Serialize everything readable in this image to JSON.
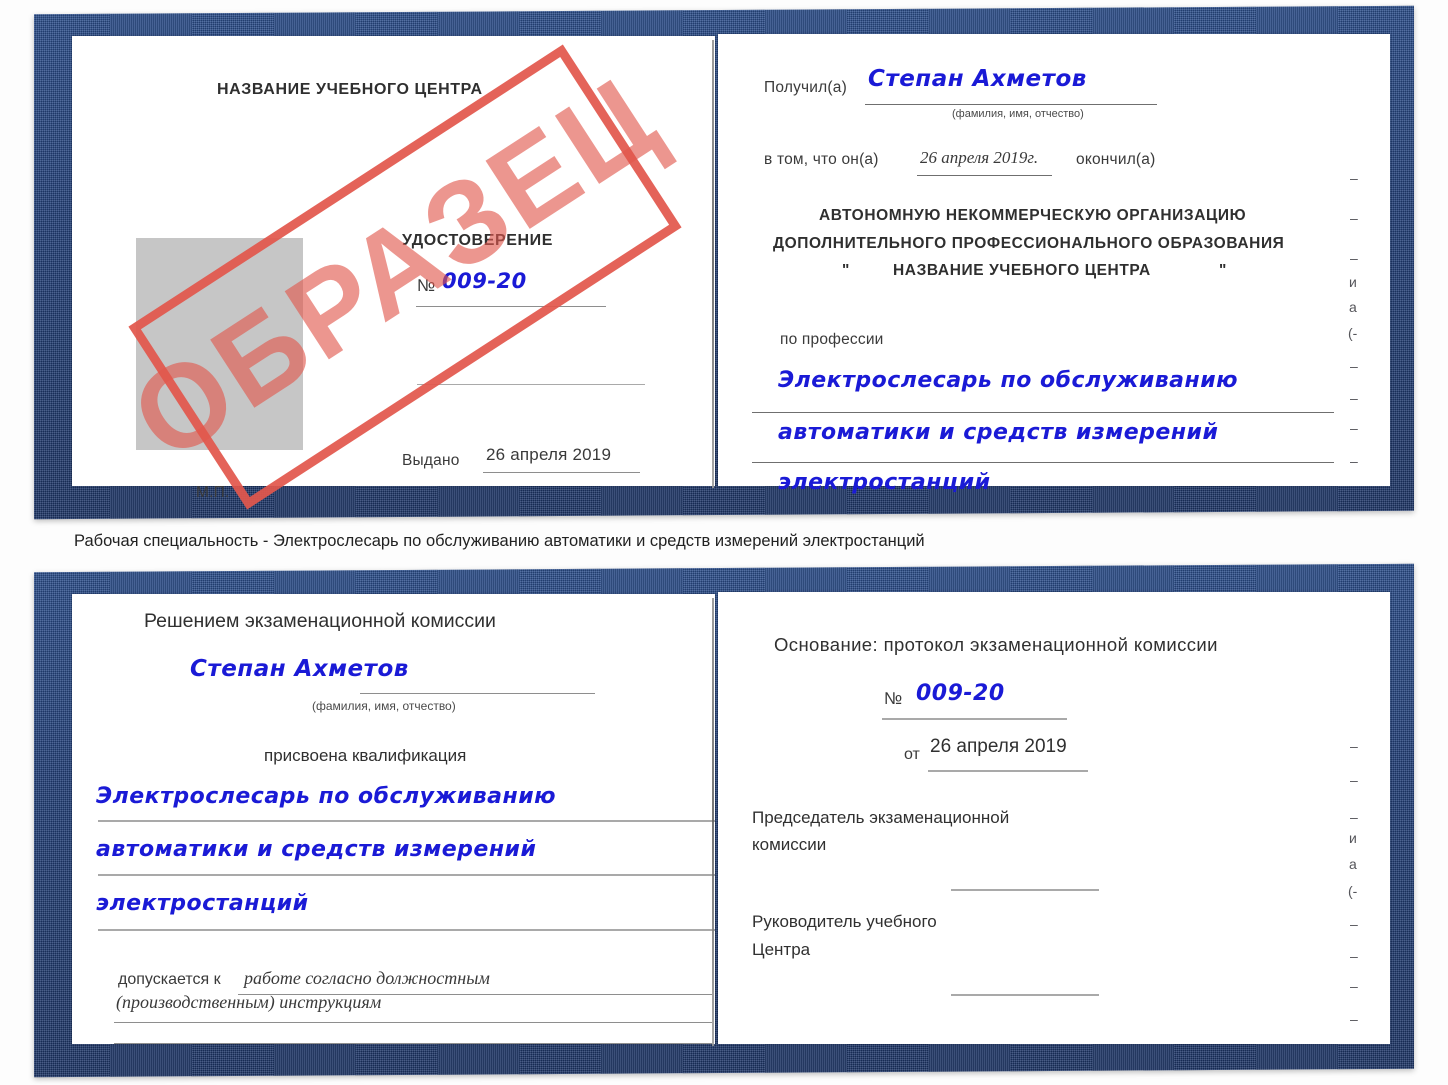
{
  "caption": {
    "text": "Рабочая специальность - Электрослесарь по обслуживанию автоматики и средств измерений электростанций"
  },
  "watermark": {
    "label": "ОБРАЗЕЦ",
    "color": "#e2574c"
  },
  "colors": {
    "cover_blue": "#22407a",
    "handwriting_blue": "#1a1ad6",
    "photo_placeholder_gray": "#c6c6c6",
    "rule_gray": "#8e8e8e"
  },
  "certificate_front": {
    "left_page": {
      "center_name": "НАЗВАНИЕ УЧЕБНОГО ЦЕНТРА",
      "doc_type": "УДОСТОВЕРЕНИЕ",
      "number_label": "№",
      "number_value": "009-20",
      "issued_label": "Выдано",
      "issued_value": "26 апреля 2019",
      "seal_label": "М.П."
    },
    "right_page": {
      "received_label": "Получил(а)",
      "received_value": "Степан Ахметов",
      "received_hint": "(фамилия, имя, отчество)",
      "in_that_label": "в том, что он(а)",
      "completion_date": "26 апреля 2019г.",
      "finished_label": "окончил(а)",
      "org_line1": "АВТОНОМНУЮ НЕКОММЕРЧЕСКУЮ ОРГАНИЗАЦИЮ",
      "org_line2": "ДОПОЛНИТЕЛЬНОГО ПРОФЕССИОНАЛЬНОГО ОБРАЗОВАНИЯ",
      "org_quote_open": "\"",
      "org_line3": "НАЗВАНИЕ УЧЕБНОГО ЦЕНТРА",
      "org_quote_close": "\"",
      "profession_label": "по профессии",
      "profession_line1": "Электрослесарь по обслуживанию",
      "profession_line2": "автоматики и средств измерений",
      "profession_line3": "электростанций",
      "edge_marks": [
        "–",
        "–",
        "–",
        "и",
        "а",
        "(-",
        "–",
        "–",
        "–",
        "–"
      ]
    }
  },
  "certificate_back": {
    "left_page": {
      "heading": "Решением экзаменационной комиссии",
      "name_value": "Степан Ахметов",
      "name_hint": "(фамилия, имя, отчество)",
      "qualification_label": "присвоена квалификация",
      "qualification_line1": "Электрослесарь по обслуживанию",
      "qualification_line2": "автоматики и средств измерений",
      "qualification_line3": "электростанций",
      "admitted_label": "допускается к",
      "admitted_line1": "работе согласно должностным",
      "admitted_line2": "(производственным) инструкциям"
    },
    "right_page": {
      "basis_label": "Основание: протокол экзаменационной комиссии",
      "number_label": "№",
      "number_value": "009-20",
      "date_label": "от",
      "date_value": "26 апреля 2019",
      "chairman_line1": "Председатель экзаменационной",
      "chairman_line2": "комиссии",
      "head_line1": "Руководитель учебного",
      "head_line2": "Центра",
      "edge_marks": [
        "–",
        "–",
        "–",
        "и",
        "а",
        "(-",
        "–",
        "–",
        "–",
        "–"
      ]
    }
  }
}
